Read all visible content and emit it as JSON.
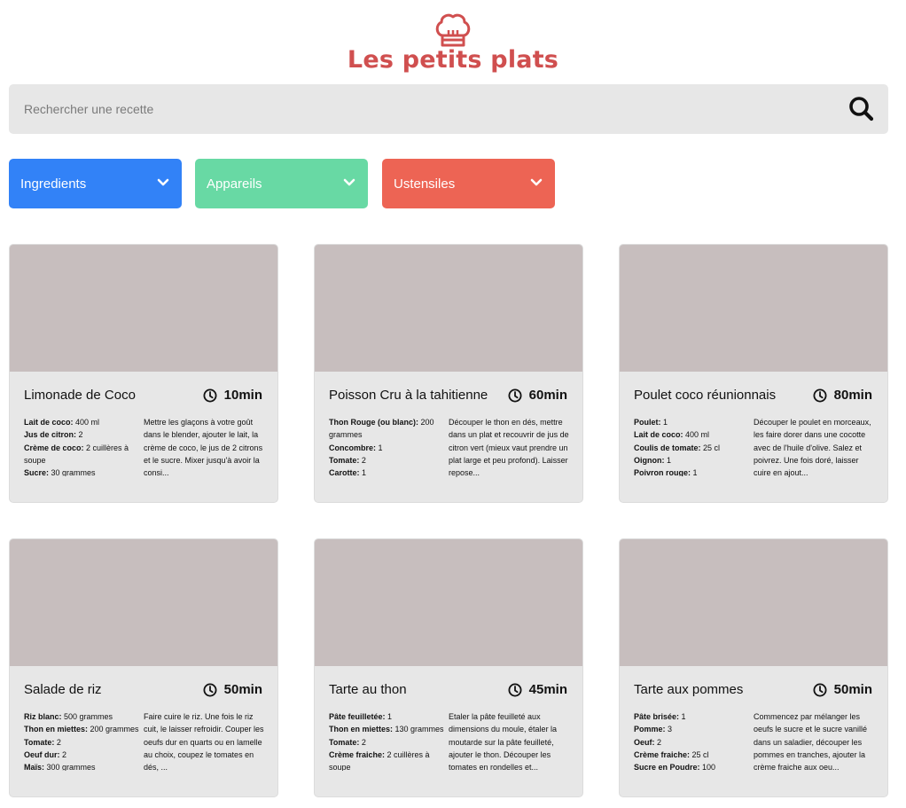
{
  "brand": {
    "name": "Les petits plats",
    "logo_icon": "chef-hat-icon",
    "color": "#D04F4F"
  },
  "search": {
    "placeholder": "Rechercher une recette",
    "value": "",
    "icon": "search-icon"
  },
  "filters": [
    {
      "label": "Ingredients",
      "color": "#3282F7",
      "icon": "chevron-down-icon"
    },
    {
      "label": "Appareils",
      "color": "#68D9A4",
      "icon": "chevron-down-icon"
    },
    {
      "label": "Ustensiles",
      "color": "#ED6454",
      "icon": "chevron-down-icon"
    }
  ],
  "recipes": [
    {
      "title": "Limonade de Coco",
      "time": "10min",
      "ingredients": [
        {
          "name": "Lait de coco:",
          "qty": " 400 ml"
        },
        {
          "name": "Jus de citron:",
          "qty": " 2"
        },
        {
          "name": "Crème de coco:",
          "qty": " 2 cuillères à soupe"
        },
        {
          "name": "Sucre:",
          "qty": " 30 grammes"
        }
      ],
      "description": "Mettre les glaçons à votre goût dans le blender, ajouter le lait, la crème de coco, le jus de 2 citrons et le sucre. Mixer jusqu'à avoir la consi..."
    },
    {
      "title": "Poisson Cru à la tahitienne",
      "time": "60min",
      "ingredients": [
        {
          "name": "Thon Rouge (ou blanc):",
          "qty": " 200 grammes"
        },
        {
          "name": "Concombre:",
          "qty": " 1"
        },
        {
          "name": "Tomate:",
          "qty": " 2"
        },
        {
          "name": "Carotte:",
          "qty": " 1"
        }
      ],
      "description": "Découper le thon en dés, mettre dans un plat et recouvrir de jus de citron vert (mieux vaut prendre un plat large et peu profond). Laisser repose..."
    },
    {
      "title": "Poulet coco réunionnais",
      "time": "80min",
      "ingredients": [
        {
          "name": "Poulet:",
          "qty": " 1"
        },
        {
          "name": "Lait de coco:",
          "qty": " 400 ml"
        },
        {
          "name": "Coulis de tomate:",
          "qty": " 25 cl"
        },
        {
          "name": "Oignon:",
          "qty": " 1"
        },
        {
          "name": "Poivron rouge:",
          "qty": " 1"
        }
      ],
      "description": "Découper le poulet en morceaux, les faire dorer dans une cocotte avec de l'huile d'olive. Salez et poivrez. Une fois doré, laisser cuire en ajout..."
    },
    {
      "title": "Salade de riz",
      "time": "50min",
      "ingredients": [
        {
          "name": "Riz blanc:",
          "qty": " 500 grammes"
        },
        {
          "name": "Thon en miettes:",
          "qty": " 200 grammes"
        },
        {
          "name": "Tomate:",
          "qty": " 2"
        },
        {
          "name": "Oeuf dur:",
          "qty": " 2"
        },
        {
          "name": "Maïs:",
          "qty": " 300 grammes"
        }
      ],
      "description": "Faire cuire le riz. Une fois le riz cuit, le laisser refroidir. Couper les oeufs dur en quarts ou en lamelle au choix, coupez le tomates en dés, ..."
    },
    {
      "title": "Tarte au thon",
      "time": "45min",
      "ingredients": [
        {
          "name": "Pâte feuilletée:",
          "qty": " 1"
        },
        {
          "name": "Thon en miettes:",
          "qty": " 130 grammes"
        },
        {
          "name": "Tomate:",
          "qty": " 2"
        },
        {
          "name": "Crème fraiche:",
          "qty": " 2 cuillères à soupe"
        }
      ],
      "description": "Etaler la pâte feuilleté aux dimensions du moule, étaler la moutarde sur la pâte feuilleté, ajouter le thon. Découper les tomates en rondelles et..."
    },
    {
      "title": "Tarte aux pommes",
      "time": "50min",
      "ingredients": [
        {
          "name": "Pâte brisée:",
          "qty": " 1"
        },
        {
          "name": "Pomme:",
          "qty": " 3"
        },
        {
          "name": "Oeuf:",
          "qty": " 2"
        },
        {
          "name": "Crème fraiche:",
          "qty": " 25 cl"
        },
        {
          "name": "Sucre en Poudre:",
          "qty": " 100 grammes"
        }
      ],
      "description": "Commencez par mélanger les oeufs le sucre et le sucre vanillé dans un saladier, découper les pommes en tranches, ajouter la crème fraiche aux oeu..."
    }
  ]
}
